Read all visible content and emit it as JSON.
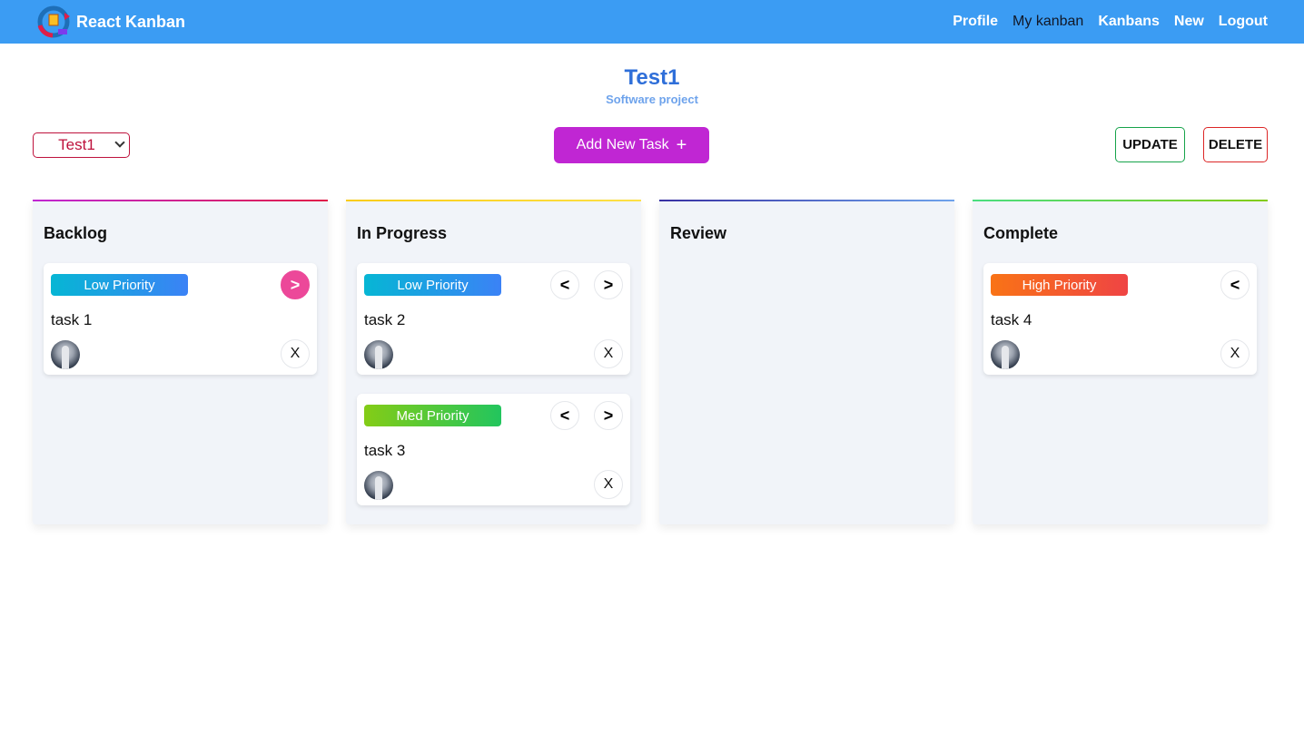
{
  "navbar": {
    "brand": "React Kanban",
    "links": [
      "Profile",
      "My kanban",
      "Kanbans",
      "New",
      "Logout"
    ],
    "active_link": "My kanban"
  },
  "header": {
    "title": "Test1",
    "subtitle": "Software project"
  },
  "toolbar": {
    "kanban_select_value": "Test1",
    "add_task_label": "Add New Task",
    "add_task_icon": "+",
    "update_label": "UPDATE",
    "delete_label": "DELETE"
  },
  "columns": [
    {
      "title": "Backlog",
      "cards": [
        {
          "priority": "Low Priority",
          "text": "task 1",
          "prev": "",
          "next": ">",
          "close": "X"
        }
      ]
    },
    {
      "title": "In Progress",
      "cards": [
        {
          "priority": "Low Priority",
          "text": "task 2",
          "prev": "<",
          "next": ">",
          "close": "X"
        },
        {
          "priority": "Med Priority",
          "text": "task 3",
          "prev": "<",
          "next": ">",
          "close": "X"
        }
      ]
    },
    {
      "title": "Review",
      "cards": []
    },
    {
      "title": "Complete",
      "cards": [
        {
          "priority": "High Priority",
          "text": "task 4",
          "prev": "<",
          "next": "",
          "close": "X"
        }
      ]
    }
  ],
  "colors": {
    "navbar": "#3b9cf3",
    "accent_button": "#c026d3",
    "update_border": "#16a34a",
    "delete_border": "#dc2626"
  }
}
